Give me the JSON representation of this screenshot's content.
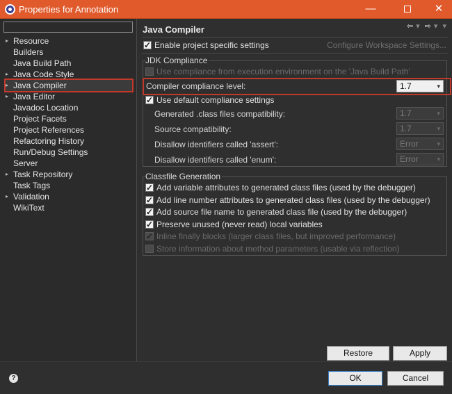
{
  "window": {
    "title": "Properties for Annotation",
    "minimize": "—",
    "close": "✕"
  },
  "sidebar": {
    "filter_value": "",
    "items": [
      {
        "label": "Resource",
        "expandable": true
      },
      {
        "label": "Builders",
        "expandable": false
      },
      {
        "label": "Java Build Path",
        "expandable": false
      },
      {
        "label": "Java Code Style",
        "expandable": true
      },
      {
        "label": "Java Compiler",
        "expandable": true,
        "selected": true
      },
      {
        "label": "Java Editor",
        "expandable": true
      },
      {
        "label": "Javadoc Location",
        "expandable": false
      },
      {
        "label": "Project Facets",
        "expandable": false
      },
      {
        "label": "Project References",
        "expandable": false
      },
      {
        "label": "Refactoring History",
        "expandable": false
      },
      {
        "label": "Run/Debug Settings",
        "expandable": false
      },
      {
        "label": "Server",
        "expandable": false
      },
      {
        "label": "Task Repository",
        "expandable": true
      },
      {
        "label": "Task Tags",
        "expandable": false
      },
      {
        "label": "Validation",
        "expandable": true
      },
      {
        "label": "WikiText",
        "expandable": false
      }
    ]
  },
  "main": {
    "title": "Java Compiler",
    "nav_back": "⇦",
    "nav_forward": "⇨",
    "enable_specific": "Enable project specific settings",
    "configure_link": "Configure Workspace Settings...",
    "jdk": {
      "group_title": "JDK Compliance",
      "use_ee": "Use compliance from execution environment on the 'Java Build Path'",
      "level_label": "Compiler compliance level:",
      "level_value": "1.7",
      "use_default": "Use default compliance settings",
      "generated_label": "Generated .class files compatibility:",
      "generated_value": "1.7",
      "source_label": "Source compatibility:",
      "source_value": "1.7",
      "assert_label": "Disallow identifiers called 'assert':",
      "assert_value": "Error",
      "enum_label": "Disallow identifiers called 'enum':",
      "enum_value": "Error"
    },
    "classfile": {
      "group_title": "Classfile Generation",
      "options": [
        {
          "label": "Add variable attributes to generated class files (used by the debugger)",
          "checked": true,
          "enabled": true
        },
        {
          "label": "Add line number attributes to generated class files (used by the debugger)",
          "checked": true,
          "enabled": true
        },
        {
          "label": "Add source file name to generated class file (used by the debugger)",
          "checked": true,
          "enabled": true
        },
        {
          "label": "Preserve unused (never read) local variables",
          "checked": true,
          "enabled": true
        },
        {
          "label": "Inline finally blocks (larger class files, but improved performance)",
          "checked": true,
          "enabled": false
        },
        {
          "label": "Store information about method parameters (usable via reflection)",
          "checked": false,
          "enabled": false
        }
      ]
    },
    "restore_defaults": "Restore Defaults",
    "apply": "Apply"
  },
  "footer": {
    "help": "?",
    "ok": "OK",
    "cancel": "Cancel"
  },
  "colors": {
    "accent": "#e05a2b",
    "highlight": "#c0392b"
  }
}
